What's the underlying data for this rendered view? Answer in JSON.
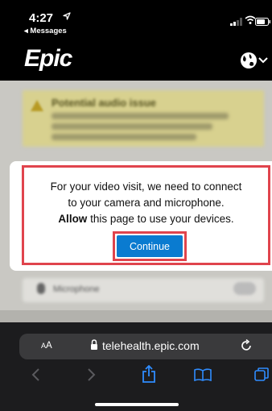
{
  "status_bar": {
    "time": "4:27",
    "back_app": "◂ Messages"
  },
  "app": {
    "logo": "Epic"
  },
  "background_page": {
    "warning_title": "Potential audio issue",
    "microphone_label": "Microphone"
  },
  "dialog": {
    "message_line1": "For your video visit, we need to connect",
    "message_line2": "to your camera and microphone.",
    "allow_word": "Allow",
    "message_line3_rest": " this page to use your devices.",
    "continue_label": "Continue"
  },
  "browser": {
    "text_size_large": "A",
    "text_size_small": "A",
    "url": "telehealth.epic.com"
  },
  "colors": {
    "accent_button": "#0a7bd0",
    "highlight_frame": "#e0444d",
    "browser_bar": "#1c1c1e",
    "warning_card": "#d8d18f"
  },
  "icons": [
    "location-arrow-icon",
    "signal-icon",
    "wifi-icon",
    "battery-icon",
    "globe-icon",
    "chevron-down-icon",
    "warning-icon",
    "microphone-icon",
    "lock-icon",
    "reload-icon",
    "back-icon",
    "forward-icon",
    "share-icon",
    "bookmarks-icon",
    "tabs-icon"
  ]
}
